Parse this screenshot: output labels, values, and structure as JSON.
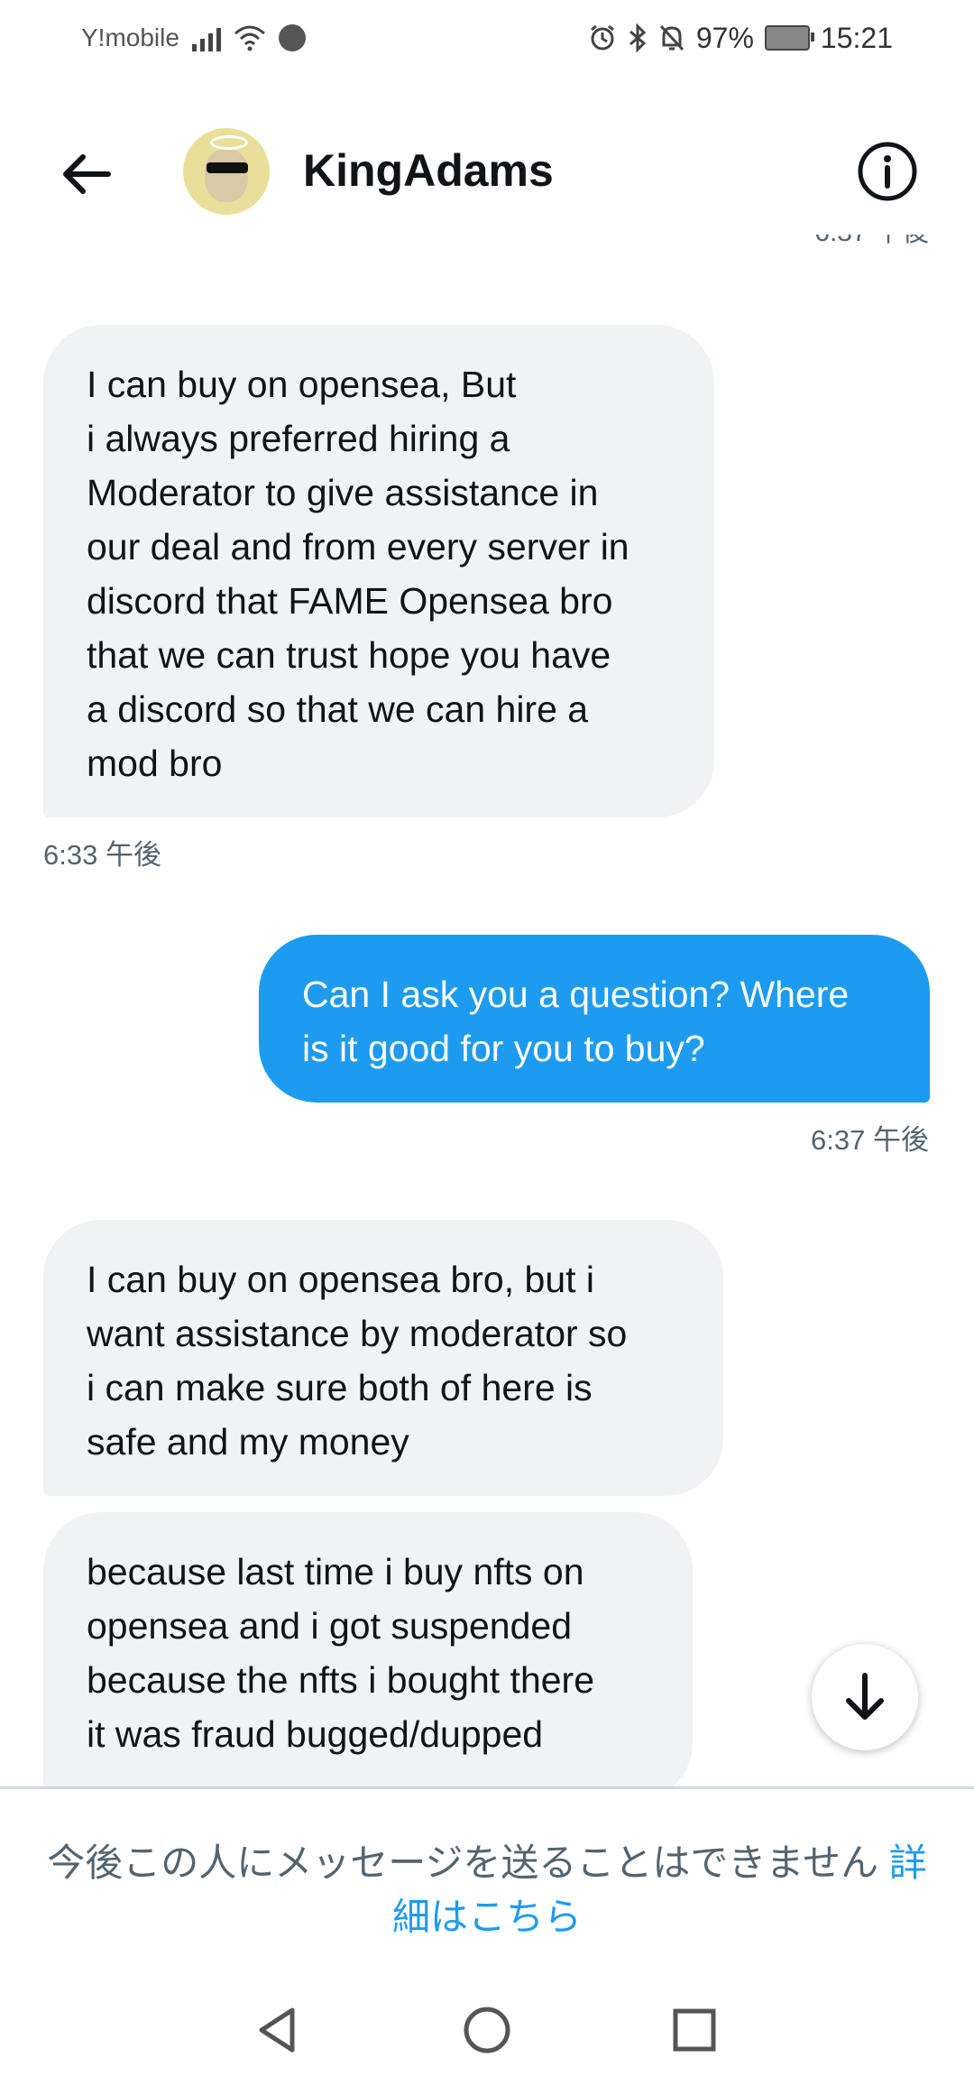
{
  "status_bar": {
    "carrier": "Y!mobile",
    "battery_percent": "97%",
    "time": "15:21",
    "icons": [
      "signal-icon",
      "wifi-icon",
      "alarm-icon",
      "bluetooth-icon",
      "bell-off-icon",
      "battery-icon"
    ]
  },
  "header": {
    "contact_name": "KingAdams",
    "back_icon": "arrow-left-icon",
    "info_icon": "info-icon"
  },
  "messages": [
    {
      "type": "received",
      "lines": [
        "I can buy on opensea, But",
        "i always preferred hiring a",
        "Moderator to give assistance in",
        "our deal and from every server in",
        "discord that FAME  Opensea bro",
        "that we can trust hope you have",
        "a discord so that we can hire a",
        "mod bro"
      ],
      "timestamp": "6:33 午後"
    },
    {
      "type": "sent",
      "lines": [
        "Can I ask you a question? Where",
        "is it good for you to buy?"
      ],
      "timestamp": "6:37 午後"
    },
    {
      "type": "received",
      "lines": [
        "I can buy on opensea bro, but i",
        "want assistance by moderator so",
        "i can make sure both of here is",
        "safe and my money"
      ]
    },
    {
      "type": "received",
      "lines": [
        "because last time i buy nfts on",
        "opensea and i got suspended",
        "because the nfts i bought there",
        "it was fraud bugged/dupped"
      ]
    }
  ],
  "scroll_down_icon": "arrow-down-icon",
  "footer": {
    "notice_text": "今後この人にメッセージを送ることはできません",
    "link_part1": "詳",
    "link_part2": "細はこちら"
  },
  "nav_bar": {
    "icons": [
      "back-triangle-icon",
      "home-circle-icon",
      "recents-square-icon"
    ]
  },
  "colors": {
    "accent": "#1d9bf0",
    "received_bubble": "#eff3f4",
    "secondary_text": "#536471"
  }
}
